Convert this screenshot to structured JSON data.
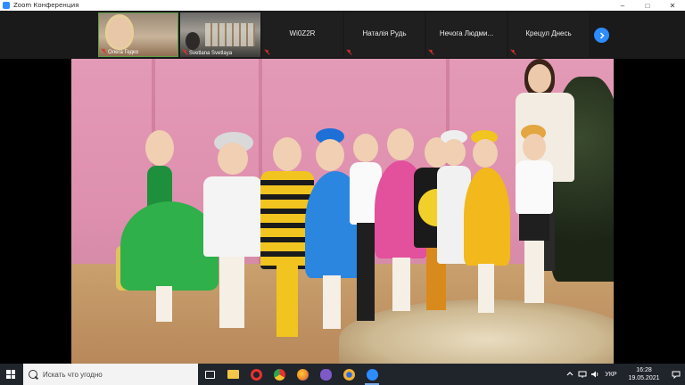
{
  "window": {
    "title": "Zoom Конференция",
    "controls": {
      "minimize": "–",
      "maximize": "□",
      "close": "✕"
    }
  },
  "gallery": {
    "tiles": [
      {
        "type": "video",
        "name": "Олега Гедко"
      },
      {
        "type": "video",
        "name": "Svetlana Svetlaya"
      },
      {
        "type": "name",
        "name": "Wi0Z2R"
      },
      {
        "type": "name",
        "name": "Наталія Рудь"
      },
      {
        "type": "name",
        "name": "Нечога  Людми..."
      },
      {
        "type": "name",
        "name": "Крецул Днесь"
      }
    ],
    "next_icon": "chevron-right-icon",
    "muted_icon": "mic-muted-icon"
  },
  "colors": {
    "zoom_blue": "#2D8CFF",
    "muted_red": "#e0312f",
    "taskbar": "#20242b"
  },
  "taskbar": {
    "search_placeholder": "Искать что угодно",
    "apps": [
      {
        "name": "task-view-icon",
        "color": "#ffffff"
      },
      {
        "name": "file-explorer-icon",
        "color": "#f3c548"
      },
      {
        "name": "opera-icon",
        "color": "#e8322f"
      },
      {
        "name": "chrome-icon",
        "color": "#e8c43a"
      },
      {
        "name": "firefox-icon",
        "color": "#f08a24"
      },
      {
        "name": "viber-icon",
        "color": "#7d5ac8"
      },
      {
        "name": "yandex-browser-icon",
        "color": "#f2b233"
      },
      {
        "name": "zoom-icon",
        "color": "#2D8CFF"
      }
    ],
    "tray": {
      "language": "УКР",
      "time": "16:28",
      "date": "19.05.2021"
    }
  }
}
